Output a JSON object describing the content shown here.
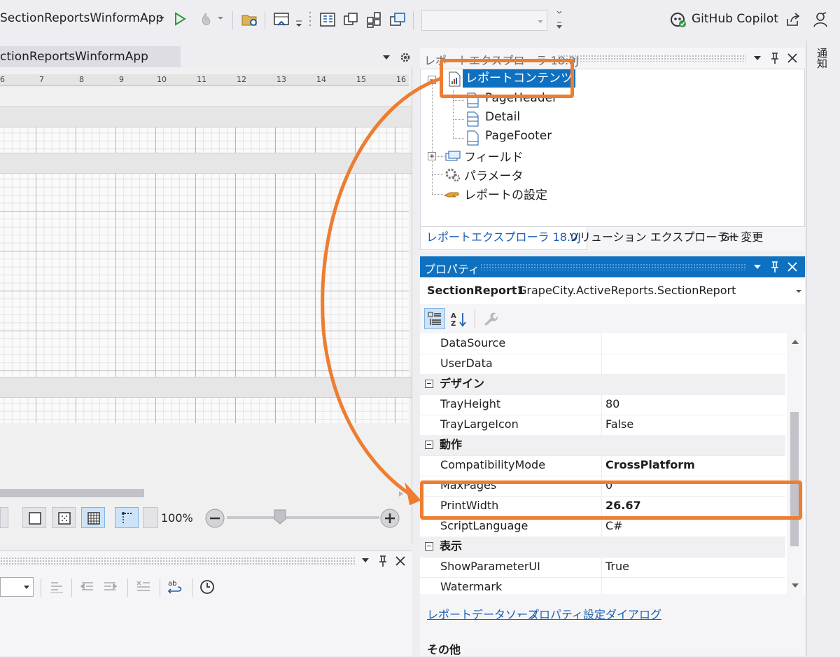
{
  "toolbar": {
    "project_dropdown": "SectionReportsWinformApp",
    "copilot_label": "GitHub Copilot"
  },
  "designer": {
    "tab_title": "ctionReportsWinformApp",
    "ruler_numbers": [
      "6",
      "7",
      "8",
      "9",
      "10",
      "11",
      "12",
      "13",
      "14",
      "15",
      "16"
    ],
    "zoom_label": "100%"
  },
  "report_explorer": {
    "title": "レポートエクスプローラ 18.0J",
    "tree": {
      "root": "レポートコンテンツ",
      "sections": [
        "PageHeader",
        "Detail",
        "PageFooter"
      ],
      "fields": "フィールド",
      "parameters": "パラメータ",
      "settings": "レポートの設定"
    },
    "tabs": [
      "レポートエクスプローラ 18.0J",
      "ソリューション エクスプローラー",
      "Git 変更"
    ]
  },
  "right_edge": {
    "vertical_tab": "通知"
  },
  "properties": {
    "title": "プロパティ",
    "object_name": "SectionReport1",
    "object_type": "GrapeCity.ActiveReports.SectionReport",
    "rows": [
      {
        "name": "DataSource",
        "value": ""
      },
      {
        "name": "UserData",
        "value": ""
      },
      {
        "category": "デザイン"
      },
      {
        "name": "TrayHeight",
        "value": "80"
      },
      {
        "name": "TrayLargeIcon",
        "value": "False"
      },
      {
        "category": "動作"
      },
      {
        "name": "CompatibilityMode",
        "value": "CrossPlatform",
        "bold": true
      },
      {
        "name": "MaxPages",
        "value": "0"
      },
      {
        "name": "PrintWidth",
        "value": "26.67",
        "bold": true
      },
      {
        "name": "ScriptLanguage",
        "value": "C#"
      },
      {
        "category": "表示"
      },
      {
        "name": "ShowParameterUI",
        "value": "True"
      },
      {
        "name": "Watermark",
        "value": ""
      }
    ],
    "links": [
      "レポートデータソース",
      "プロパティ設定ダイアログ"
    ],
    "links_separator": ",",
    "other_category": "その他"
  },
  "colors": {
    "accent": "#0e70c0",
    "highlight": "#ed7d31",
    "link": "#1a5fb4"
  }
}
